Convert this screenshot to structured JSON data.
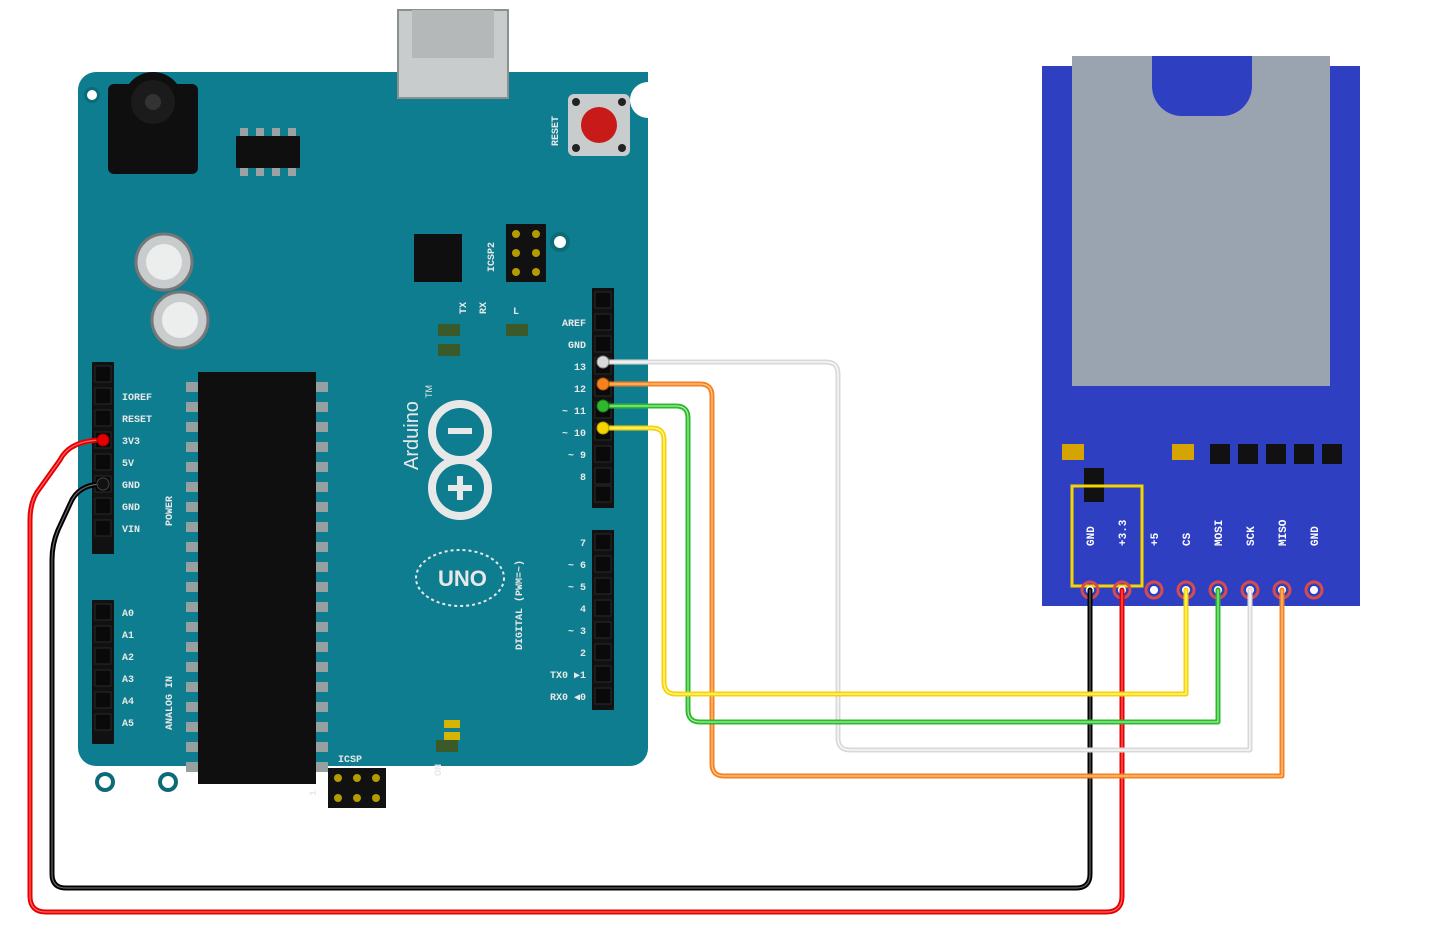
{
  "arduino": {
    "brand": "Arduino",
    "model": "UNO",
    "tm": "TM",
    "reset": "RESET",
    "icsp2": "ICSP2",
    "icsp": "ICSP",
    "tx": "TX",
    "rx": "RX",
    "l": "L",
    "on": "ON",
    "power_label": "POWER",
    "analog_in_label": "ANALOG IN",
    "digital_label": "DIGITAL (PWM=~)",
    "power_pins": {
      "ioref": "IOREF",
      "reset": "RESET",
      "3v3": "3V3",
      "5v": "5V",
      "gnd1": "GND",
      "gnd2": "GND",
      "vin": "VIN"
    },
    "analog_pins": [
      "A0",
      "A1",
      "A2",
      "A3",
      "A4",
      "A5"
    ],
    "digital_pins": {
      "aref": "AREF",
      "gnd": "GND",
      "13": "13",
      "12": "12",
      "11": "~ 11",
      "10": "~ 10",
      "9": "~ 9",
      "8": "8",
      "7": "7",
      "6": "~ 6",
      "5": "~ 5",
      "4": "4",
      "3": "~ 3",
      "2": "2",
      "tx1": "TX0 ▶1",
      "rx0": "RX0 ◀0"
    }
  },
  "sd_module": {
    "pins": [
      "GND",
      "+3.3",
      "+5",
      "CS",
      "MOSI",
      "SCK",
      "MISO",
      "GND"
    ]
  },
  "wires": [
    {
      "name": "3v3-to-sd3v3",
      "color": "#e60000",
      "from": "arduino.3V3",
      "to": "sd.+3.3"
    },
    {
      "name": "gnd-to-sdgnd",
      "color": "#000000",
      "from": "arduino.GND",
      "to": "sd.GND"
    },
    {
      "name": "d10-to-cs",
      "color": "#f5d400",
      "from": "arduino.D10",
      "to": "sd.CS"
    },
    {
      "name": "d11-to-mosi",
      "color": "#2fb82f",
      "from": "arduino.D11",
      "to": "sd.MOSI"
    },
    {
      "name": "d13-to-sck",
      "color": "#d9d9d9",
      "from": "arduino.D13",
      "to": "sd.SCK"
    },
    {
      "name": "d12-to-miso",
      "color": "#f58220",
      "from": "arduino.D12",
      "to": "sd.MISO"
    }
  ],
  "colors": {
    "board": "#0f7a8c",
    "board_dark": "#0a5d6b",
    "sd_board": "#2e3fb8",
    "sd_slot": "#9aa4b0",
    "header": "#1a1a1a",
    "ic": "#1a1a1a",
    "silver": "#c9c9c9",
    "red_btn": "#c91a1a"
  }
}
